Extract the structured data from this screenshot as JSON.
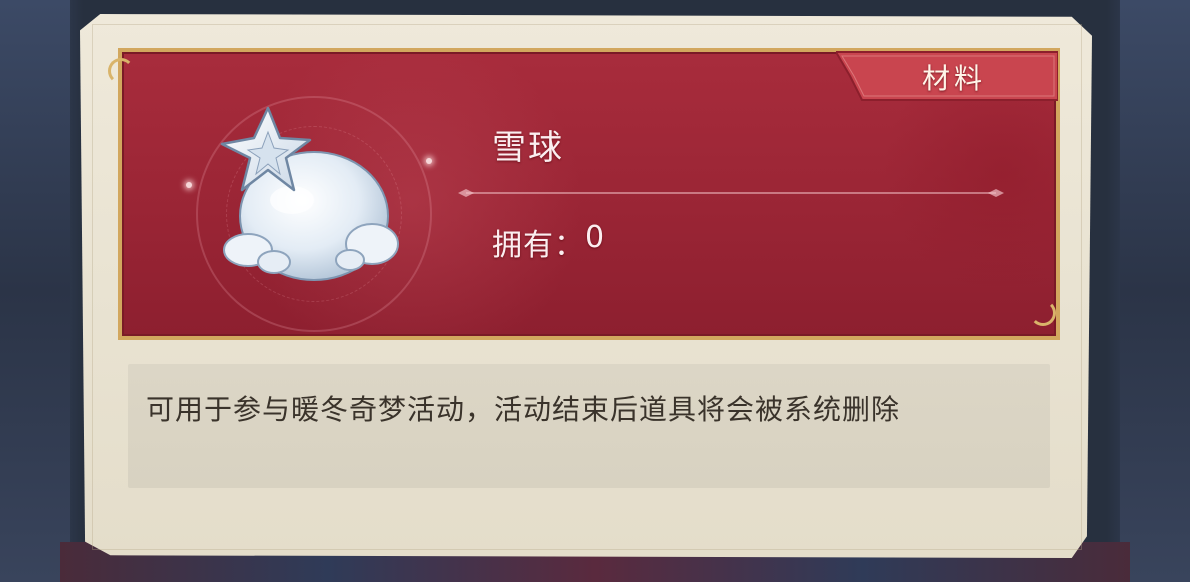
{
  "item": {
    "name": "雪球",
    "owned_label": "拥有：",
    "owned_count": "0",
    "category": "材料",
    "description": "可用于参与暖冬奇梦活动，活动结束后道具将会被系统删除"
  },
  "icons": {
    "item_icon": "snowball-icon"
  },
  "colors": {
    "banner": "#9a2535",
    "banner_border": "#d2a75e",
    "parchment": "#e9e3d2",
    "text_light": "#fbeef0",
    "text_dark": "#3a332b"
  }
}
